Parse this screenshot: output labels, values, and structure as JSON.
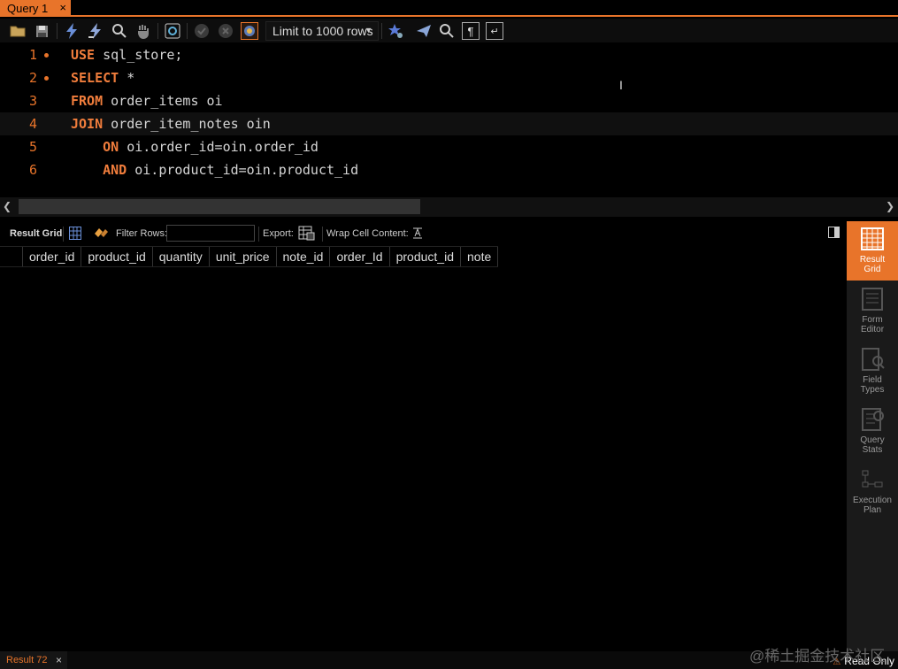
{
  "tabs": {
    "query_tab_label": "Query 1",
    "close_glyph": "×"
  },
  "toolbar": {
    "limit_label": "Limit to 1000 rows"
  },
  "editor": {
    "lines": [
      {
        "num": "1",
        "kw": "USE",
        "rest": " sql_store;"
      },
      {
        "num": "2",
        "kw": "SELECT",
        "rest": " *"
      },
      {
        "num": "3",
        "kw": "FROM",
        "rest": " order_items oi"
      },
      {
        "num": "4",
        "kw": "JOIN",
        "rest": " order_item_notes oin"
      },
      {
        "num": "5",
        "indent": "    ",
        "kw": "ON",
        "rest": " oi.order_id=oin.order_id"
      },
      {
        "num": "6",
        "indent": "    ",
        "kw": "AND",
        "rest": " oi.product_id=oin.product_id"
      }
    ]
  },
  "result_toolbar": {
    "result_grid_label": "Result Grid",
    "filter_rows_label": "Filter Rows:",
    "filter_value": "",
    "export_label": "Export:",
    "wrap_label": "Wrap Cell Content:"
  },
  "grid": {
    "columns": [
      "order_id",
      "product_id",
      "quantity",
      "unit_price",
      "note_id",
      "order_Id",
      "product_id",
      "note"
    ]
  },
  "sidebar": {
    "items": [
      {
        "line1": "Result",
        "line2": "Grid"
      },
      {
        "line1": "Form",
        "line2": "Editor"
      },
      {
        "line1": "Field",
        "line2": "Types"
      },
      {
        "line1": "Query",
        "line2": "Stats"
      },
      {
        "line1": "Execution",
        "line2": "Plan"
      }
    ]
  },
  "status": {
    "result_tab_label": "Result 72",
    "read_only_label": "Read Only",
    "watermark": "@稀土掘金技术社区"
  },
  "colors": {
    "accent": "#e8742a",
    "background": "#000000"
  }
}
